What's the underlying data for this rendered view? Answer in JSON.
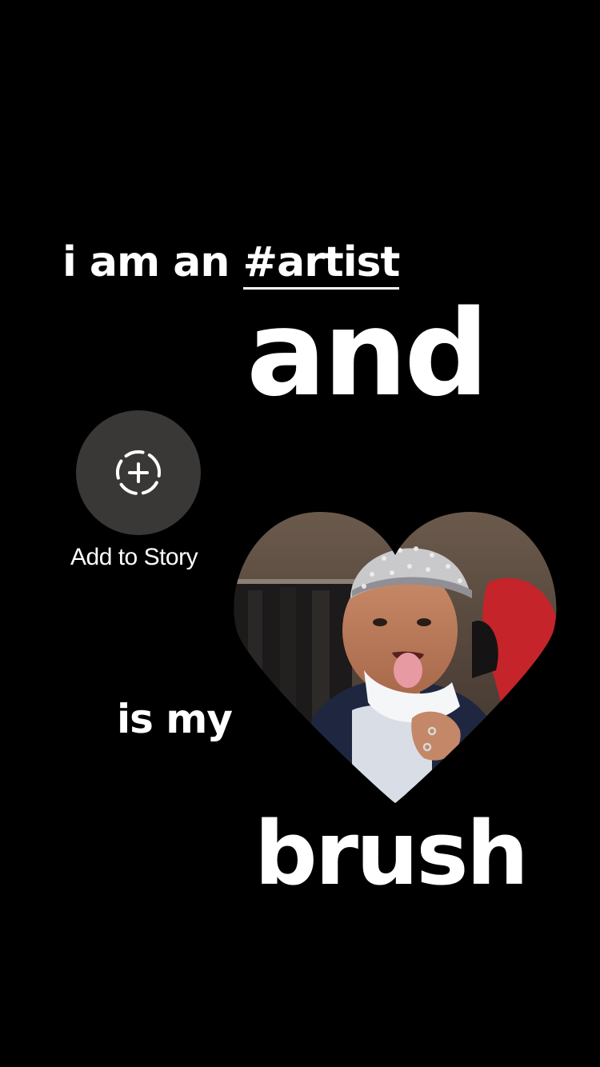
{
  "story": {
    "line1_prefix": "i am an ",
    "hashtag": "#artist",
    "word_and": "and",
    "phrase_is_my": "is my",
    "word_brush": "brush"
  },
  "add_to_story": {
    "label": "Add to Story",
    "icon": "add-circle-dashed-icon"
  },
  "colors": {
    "background": "#000000",
    "text": "#ffffff",
    "button_bg": "#3a3836"
  }
}
